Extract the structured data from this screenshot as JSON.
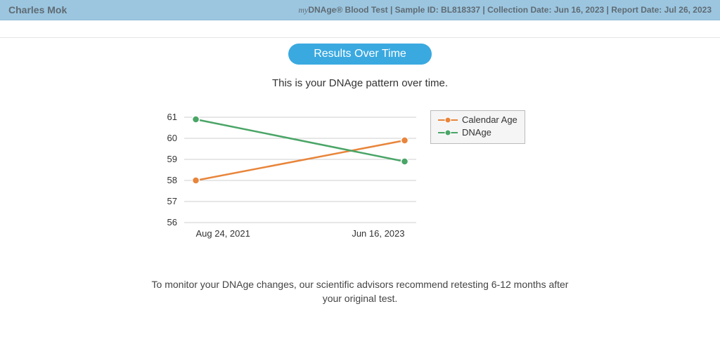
{
  "header": {
    "name": "Charles Mok",
    "brand_prefix": "my",
    "brand_rest": "DNAge® Blood Test",
    "sample_label": "Sample ID",
    "sample_id": "BL818337",
    "collection_label": "Collection Date",
    "collection_date": "Jun 16, 2023",
    "report_label": "Report Date",
    "report_date": "Jul 26, 2023"
  },
  "pill_label": "Results Over Time",
  "subtitle": "This is your DNAge pattern over time.",
  "footer_note": "To monitor your DNAge changes, our scientific advisors recommend retesting 6-12 months after your original test.",
  "colors": {
    "calendar_age": "#e8853b",
    "dnage": "#4aa567"
  },
  "chart_data": {
    "type": "line",
    "x_categories": [
      "Aug 24, 2021",
      "Jun 16, 2023"
    ],
    "y_ticks": [
      56,
      57,
      58,
      59,
      60,
      61
    ],
    "ylim": [
      56,
      61
    ],
    "series": [
      {
        "name": "Calendar Age",
        "values": [
          58.0,
          59.9
        ],
        "color_key": "calendar_age"
      },
      {
        "name": "DNAge",
        "values": [
          60.9,
          58.9
        ],
        "color_key": "dnage"
      }
    ],
    "legend": [
      "Calendar Age",
      "DNAge"
    ],
    "title": "",
    "xlabel": "",
    "ylabel": ""
  }
}
